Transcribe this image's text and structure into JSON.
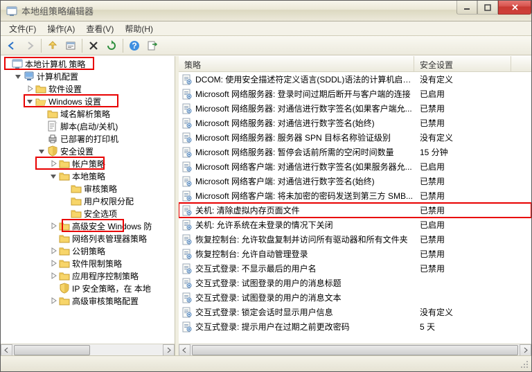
{
  "window": {
    "title": "本地组策略编辑器"
  },
  "menu": {
    "file": "文件(F)",
    "action": "操作(A)",
    "view": "查看(V)",
    "help": "帮助(H)"
  },
  "tree": {
    "root": "本地计算机 策略",
    "computer_config": "计算机配置",
    "software_settings": "软件设置",
    "windows_settings": "Windows 设置",
    "name_resolution": "域名解析策略",
    "scripts": "脚本(启动/关机)",
    "deployed_printers": "已部署的打印机",
    "security_settings": "安全设置",
    "account_policies": "帐户策略",
    "local_policies": "本地策略",
    "audit_policy": "审核策略",
    "user_rights": "用户权限分配",
    "security_options": "安全选项",
    "advanced_windows_fw": "高级安全 Windows 防",
    "network_list_mgr": "网络列表管理器策略",
    "public_key": "公钥策略",
    "software_restriction": "软件限制策略",
    "app_control": "应用程序控制策略",
    "ip_security": "IP 安全策略，在 本地",
    "advanced_audit": "高级审核策略配置"
  },
  "columns": {
    "policy": "策略",
    "setting": "安全设置"
  },
  "col_widths": {
    "c1": 340,
    "c2": 140
  },
  "rows": [
    {
      "label": "DCOM: 使用安全描述符定义语言(SDDL)语法的计算机启动...",
      "value": "没有定义"
    },
    {
      "label": "Microsoft 网络服务器: 登录时间过期后断开与客户端的连接",
      "value": "已启用"
    },
    {
      "label": "Microsoft 网络服务器: 对通信进行数字签名(如果客户端允...",
      "value": "已禁用"
    },
    {
      "label": "Microsoft 网络服务器: 对通信进行数字签名(始终)",
      "value": "已禁用"
    },
    {
      "label": "Microsoft 网络服务器: 服务器 SPN 目标名称验证级别",
      "value": "没有定义"
    },
    {
      "label": "Microsoft 网络服务器: 暂停会话前所需的空闲时间数量",
      "value": "15 分钟"
    },
    {
      "label": "Microsoft 网络客户端: 对通信进行数字签名(如果服务器允...",
      "value": "已启用"
    },
    {
      "label": "Microsoft 网络客户端: 对通信进行数字签名(始终)",
      "value": "已禁用"
    },
    {
      "label": "Microsoft 网络客户端: 将未加密的密码发送到第三方 SMB...",
      "value": "已禁用"
    },
    {
      "label": "关机: 清除虚拟内存页面文件",
      "value": "已禁用",
      "highlight": true
    },
    {
      "label": "关机: 允许系统在未登录的情况下关闭",
      "value": "已启用"
    },
    {
      "label": "恢复控制台: 允许软盘复制并访问所有驱动器和所有文件夹",
      "value": "已禁用"
    },
    {
      "label": "恢复控制台: 允许自动管理登录",
      "value": "已禁用"
    },
    {
      "label": "交互式登录: 不显示最后的用户名",
      "value": "已禁用"
    },
    {
      "label": "交互式登录: 试图登录的用户的消息标题",
      "value": ""
    },
    {
      "label": "交互式登录: 试图登录的用户的消息文本",
      "value": ""
    },
    {
      "label": "交互式登录: 锁定会话时显示用户信息",
      "value": "没有定义"
    },
    {
      "label": "交互式登录: 提示用户在过期之前更改密码",
      "value": "5 天"
    }
  ]
}
